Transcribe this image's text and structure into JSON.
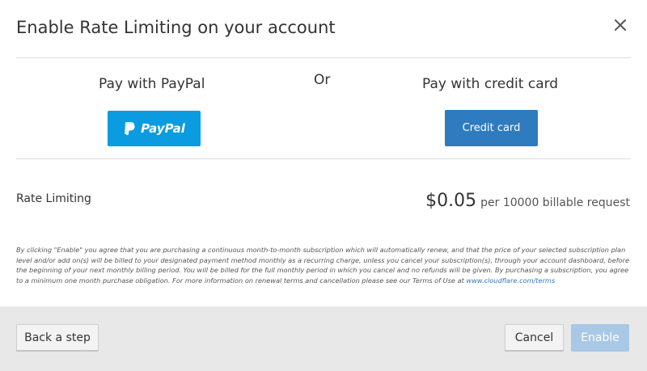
{
  "dialog": {
    "title": "Enable Rate Limiting on your account",
    "close_icon": "close-icon"
  },
  "payment": {
    "paypal_heading": "Pay with PayPal",
    "or_label": "Or",
    "card_heading": "Pay with credit card",
    "paypal_button_label": "PayPal",
    "paypal_button_color": "#0a9be0",
    "card_button_label": "Credit card",
    "card_button_color": "#2f7bbf"
  },
  "plan": {
    "name": "Rate Limiting",
    "price": "$0.05",
    "unit": "per 10000 billable request"
  },
  "terms": {
    "text": "By clicking \"Enable\" you agree that you are purchasing a continuous month-to-month subscription which will automatically renew, and that the price of your selected subscription plan level and/or add on(s) will be billed to your designated payment method monthly as a recurring charge, unless you cancel your subscription(s), through your account dashboard, before the beginning of your next monthly billing period. You will be billed for the full monthly period in which you cancel and no refunds will be given. By purchasing a subscription, you agree to a minimum one month purchase obligation. For more information on renewal terms and cancellation please see our Terms of Use at",
    "link_text": "www.cloudflare.com/terms"
  },
  "footer": {
    "back_label": "Back a step",
    "cancel_label": "Cancel",
    "enable_label": "Enable",
    "enable_state": "disabled"
  }
}
